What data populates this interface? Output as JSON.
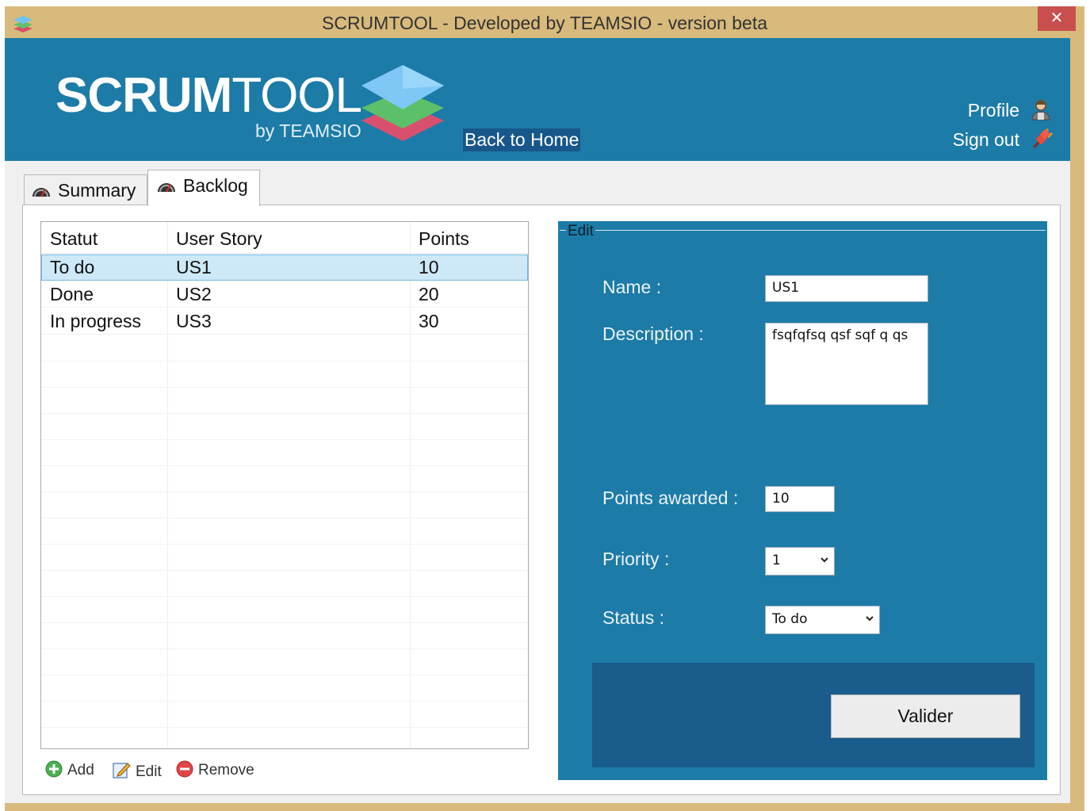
{
  "window": {
    "title": "SCRUMTOOL - Developed by TEAMSIO - version beta",
    "close_label": "✕"
  },
  "header": {
    "logo_bold": "SCRUM",
    "logo_light": "TOOL",
    "logo_sub": "by TEAMSIO",
    "back_home": "Back to Home",
    "profile": "Profile",
    "sign_out": "Sign out"
  },
  "tabs": [
    {
      "label": "Summary",
      "selected": false
    },
    {
      "label": "Backlog",
      "selected": true
    }
  ],
  "backlog": {
    "columns": [
      "Statut",
      "User Story",
      "Points"
    ],
    "rows": [
      {
        "statut": "To do",
        "story": "US1",
        "points": "10",
        "selected": true
      },
      {
        "statut": "Done",
        "story": "US2",
        "points": "20",
        "selected": false
      },
      {
        "statut": "In progress",
        "story": "US3",
        "points": "30",
        "selected": false
      }
    ]
  },
  "actions": {
    "add": "Add",
    "edit": "Edit",
    "remove": "Remove"
  },
  "edit_form": {
    "legend": "Edit",
    "name_label": "Name :",
    "name_value": "US1",
    "description_label": "Description :",
    "description_value": "fsqfqfsq qsf sqf q qs",
    "points_label": "Points awarded :",
    "points_value": "10",
    "priority_label": "Priority :",
    "priority_value": "1",
    "status_label": "Status :",
    "status_value": "To do",
    "submit_label": "Valider"
  },
  "colors": {
    "accent_blue": "#1d7ba7",
    "dark_blue": "#1a5c8c",
    "frame": "#d7ba7c",
    "close_red": "#c94f4f",
    "selection": "#cde8f7"
  },
  "icons": [
    "app-stack-icon",
    "close-icon",
    "profile-user-icon",
    "sign-out-plug-icon",
    "gauge-icon",
    "add-icon",
    "edit-icon",
    "remove-icon",
    "chevron-down-icon"
  ]
}
